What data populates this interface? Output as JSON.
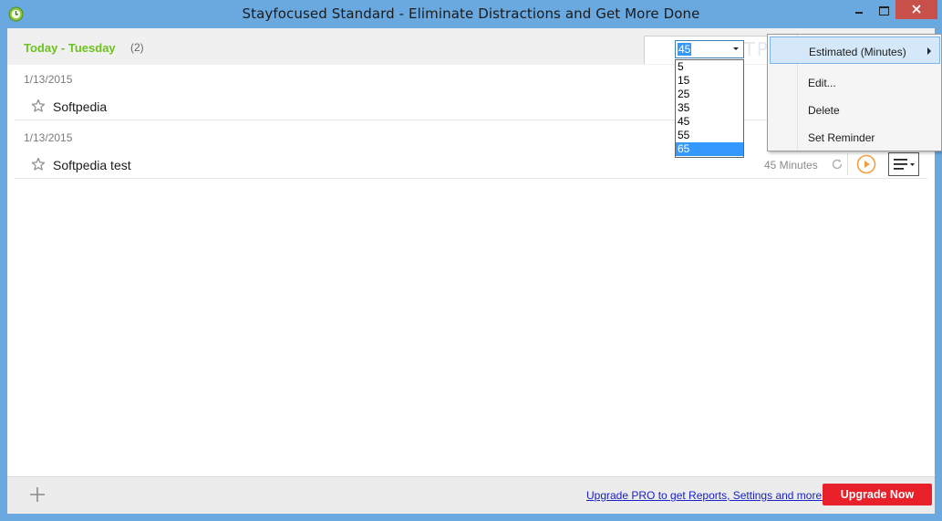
{
  "window": {
    "title": "Stayfocused Standard - Eliminate Distractions and Get More Done"
  },
  "header": {
    "day_title": "Today - Tuesday",
    "count": "(2)"
  },
  "tasks": [
    {
      "date": "1/13/2015",
      "name": "Softpedia"
    },
    {
      "date": "1/13/2015",
      "name": "Softpedia test",
      "estimate": "45 Minutes"
    }
  ],
  "estimate_combo": {
    "value": "45",
    "options": [
      "5",
      "15",
      "25",
      "35",
      "45",
      "55",
      "65"
    ],
    "highlighted": "65"
  },
  "context_menu": {
    "items": [
      {
        "label": "Estimated (Minutes)",
        "has_submenu": true
      },
      {
        "label": "Edit..."
      },
      {
        "label": "Delete"
      },
      {
        "label": "Set Reminder"
      }
    ]
  },
  "footer": {
    "upgrade_link": "Upgrade PRO to get Reports, Settings and more.",
    "upgrade_button": "Upgrade Now"
  },
  "watermark": "SOFTPEDIA",
  "colors": {
    "accent_green": "#6cc31f",
    "upgrade_red": "#e8202a",
    "link_blue": "#1a22c8",
    "play_orange": "#f0a040"
  }
}
